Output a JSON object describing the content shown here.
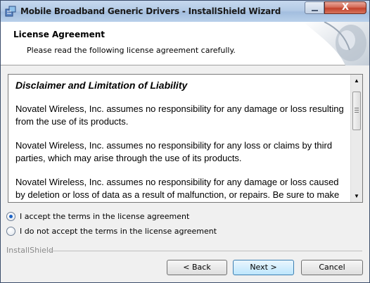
{
  "window": {
    "title": "Mobile Broadband Generic Drivers - InstallShield Wizard",
    "close_glyph": "X",
    "icons": [
      "installer-icon",
      "minimize-icon",
      "close-icon"
    ]
  },
  "header": {
    "title": "License Agreement",
    "subtitle": "Please read the following license agreement carefully."
  },
  "license": {
    "heading": "Disclaimer and Limitation of Liability",
    "paragraphs": [
      "Novatel Wireless, Inc. assumes no responsibility for any damage or loss resulting from the use of its products.",
      "Novatel Wireless, Inc. assumes no responsibility for any loss or claims by third parties, which may arise through the use of its products.",
      "Novatel Wireless, Inc. assumes no responsibility for any damage or loss caused by deletion or loss of data as a result of malfunction, or repairs.  Be sure to make backup copies of all important data on other media to protect against data loss."
    ]
  },
  "options": {
    "accept_label": "I accept the terms in the license agreement",
    "decline_label": "I do not accept the terms in the license agreement",
    "selected": "accept"
  },
  "footer": {
    "brand": "InstallShield",
    "back_label": "< Back",
    "next_label": "Next >",
    "cancel_label": "Cancel"
  },
  "colors": {
    "accent": "#1d63c5",
    "close_button": "#c2432c"
  }
}
